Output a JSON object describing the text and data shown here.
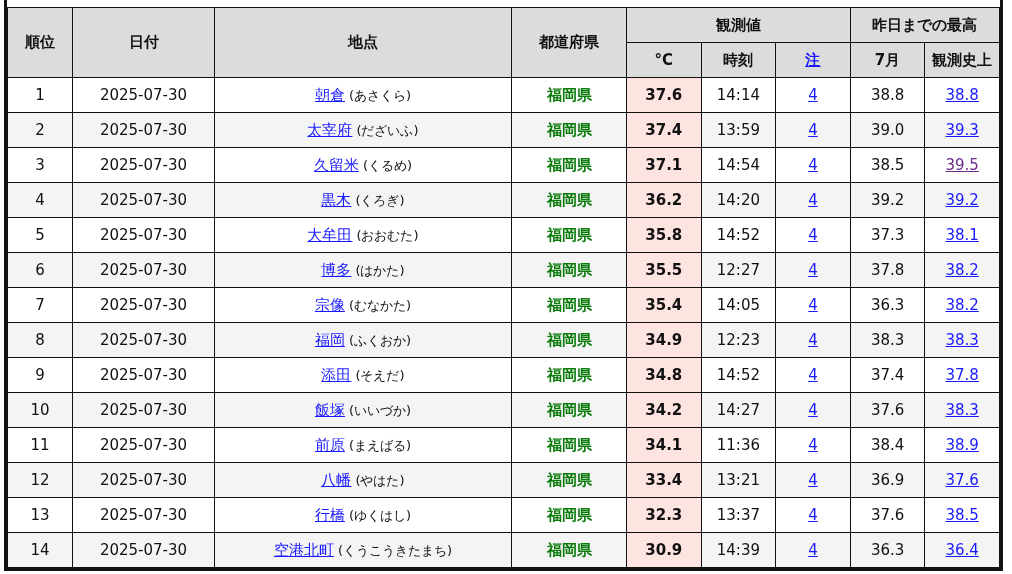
{
  "table": {
    "header_groups": [
      {
        "label": "観測値"
      },
      {
        "label": "昨日までの最高"
      }
    ],
    "columns": [
      {
        "label": "順位",
        "kind": "plain"
      },
      {
        "label": "日付",
        "kind": "plain"
      },
      {
        "label": "地点",
        "kind": "plain"
      },
      {
        "label": "都道府県",
        "kind": "plain"
      },
      {
        "label": "°C",
        "kind": "plain"
      },
      {
        "label": "時刻",
        "kind": "plain"
      },
      {
        "label": "注",
        "kind": "link"
      },
      {
        "label": "7月",
        "kind": "plain"
      },
      {
        "label": "観測史上",
        "kind": "plain"
      }
    ],
    "rows": [
      {
        "rank": "1",
        "date": "2025-07-30",
        "place": "朝倉",
        "reading": "(あさくら)",
        "prefecture": "福岡県",
        "temp": "37.6",
        "time": "14:14",
        "note": "4",
        "month_max": "38.8",
        "record": "38.8",
        "record_visited": false
      },
      {
        "rank": "2",
        "date": "2025-07-30",
        "place": "太宰府",
        "reading": "(だざいふ)",
        "prefecture": "福岡県",
        "temp": "37.4",
        "time": "13:59",
        "note": "4",
        "month_max": "39.0",
        "record": "39.3",
        "record_visited": false
      },
      {
        "rank": "3",
        "date": "2025-07-30",
        "place": "久留米",
        "reading": "(くるめ)",
        "prefecture": "福岡県",
        "temp": "37.1",
        "time": "14:54",
        "note": "4",
        "month_max": "38.5",
        "record": "39.5",
        "record_visited": true
      },
      {
        "rank": "4",
        "date": "2025-07-30",
        "place": "黒木",
        "reading": "(くろぎ)",
        "prefecture": "福岡県",
        "temp": "36.2",
        "time": "14:20",
        "note": "4",
        "month_max": "39.2",
        "record": "39.2",
        "record_visited": false
      },
      {
        "rank": "5",
        "date": "2025-07-30",
        "place": "大牟田",
        "reading": "(おおむた)",
        "prefecture": "福岡県",
        "temp": "35.8",
        "time": "14:52",
        "note": "4",
        "month_max": "37.3",
        "record": "38.1",
        "record_visited": false
      },
      {
        "rank": "6",
        "date": "2025-07-30",
        "place": "博多",
        "reading": "(はかた)",
        "prefecture": "福岡県",
        "temp": "35.5",
        "time": "12:27",
        "note": "4",
        "month_max": "37.8",
        "record": "38.2",
        "record_visited": false
      },
      {
        "rank": "7",
        "date": "2025-07-30",
        "place": "宗像",
        "reading": "(むなかた)",
        "prefecture": "福岡県",
        "temp": "35.4",
        "time": "14:05",
        "note": "4",
        "month_max": "36.3",
        "record": "38.2",
        "record_visited": false
      },
      {
        "rank": "8",
        "date": "2025-07-30",
        "place": "福岡",
        "reading": "(ふくおか)",
        "prefecture": "福岡県",
        "temp": "34.9",
        "time": "12:23",
        "note": "4",
        "month_max": "38.3",
        "record": "38.3",
        "record_visited": false
      },
      {
        "rank": "9",
        "date": "2025-07-30",
        "place": "添田",
        "reading": "(そえだ)",
        "prefecture": "福岡県",
        "temp": "34.8",
        "time": "14:52",
        "note": "4",
        "month_max": "37.4",
        "record": "37.8",
        "record_visited": false
      },
      {
        "rank": "10",
        "date": "2025-07-30",
        "place": "飯塚",
        "reading": "(いいづか)",
        "prefecture": "福岡県",
        "temp": "34.2",
        "time": "14:27",
        "note": "4",
        "month_max": "37.6",
        "record": "38.3",
        "record_visited": false
      },
      {
        "rank": "11",
        "date": "2025-07-30",
        "place": "前原",
        "reading": "(まえばる)",
        "prefecture": "福岡県",
        "temp": "34.1",
        "time": "11:36",
        "note": "4",
        "month_max": "38.4",
        "record": "38.9",
        "record_visited": false
      },
      {
        "rank": "12",
        "date": "2025-07-30",
        "place": "八幡",
        "reading": "(やはた)",
        "prefecture": "福岡県",
        "temp": "33.4",
        "time": "13:21",
        "note": "4",
        "month_max": "36.9",
        "record": "37.6",
        "record_visited": false
      },
      {
        "rank": "13",
        "date": "2025-07-30",
        "place": "行橋",
        "reading": "(ゆくはし)",
        "prefecture": "福岡県",
        "temp": "32.3",
        "time": "13:37",
        "note": "4",
        "month_max": "37.6",
        "record": "38.5",
        "record_visited": false
      },
      {
        "rank": "14",
        "date": "2025-07-30",
        "place": "空港北町",
        "reading": "(くうこうきたまち)",
        "prefecture": "福岡県",
        "temp": "30.9",
        "time": "14:39",
        "note": "4",
        "month_max": "36.3",
        "record": "36.4",
        "record_visited": false
      }
    ]
  }
}
